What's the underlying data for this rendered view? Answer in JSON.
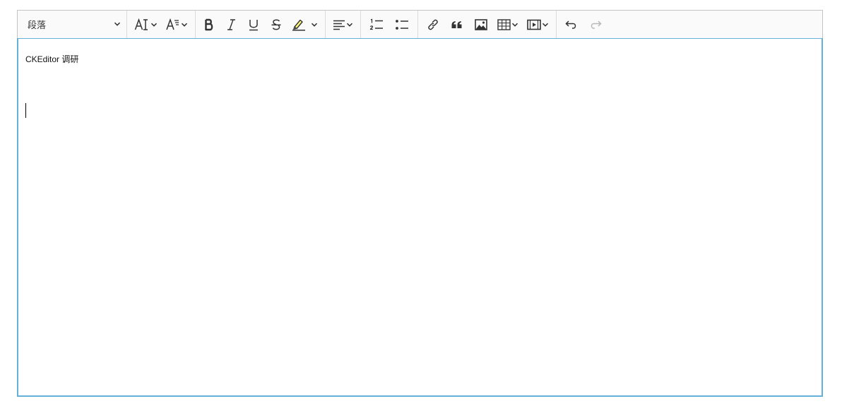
{
  "toolbar": {
    "heading_label": "段落"
  },
  "content": {
    "paragraph": "CKEditor 调研"
  },
  "colors": {
    "focus_border": "#64b0d9",
    "toolbar_bg": "#fafafa",
    "toolbar_border": "#c4c4c4"
  },
  "icons": [
    "chevron-down-icon",
    "font-size-icon",
    "font-family-icon",
    "bold-icon",
    "italic-icon",
    "underline-icon",
    "strikethrough-icon",
    "highlight-icon",
    "align-left-icon",
    "numbered-list-icon",
    "bulleted-list-icon",
    "link-icon",
    "blockquote-icon",
    "image-icon",
    "table-icon",
    "media-icon",
    "undo-icon",
    "redo-icon"
  ]
}
